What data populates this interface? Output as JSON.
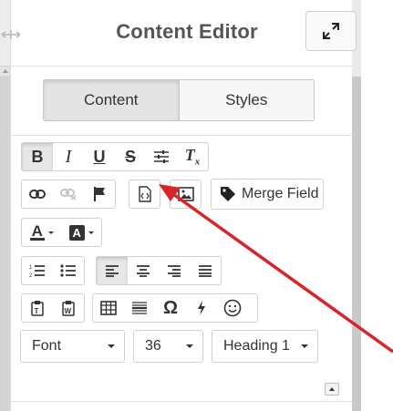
{
  "header": {
    "title": "Content Editor"
  },
  "tabs": [
    {
      "label": "Content",
      "active": true
    },
    {
      "label": "Styles",
      "active": false
    }
  ],
  "toolbar": {
    "row1": [
      {
        "name": "bold-button",
        "glyph": "B"
      },
      {
        "name": "italic-button",
        "glyph": "I"
      },
      {
        "name": "underline-button",
        "glyph": "U"
      },
      {
        "name": "strikethrough-button",
        "glyph": "S"
      },
      {
        "name": "indent-settings-button",
        "icon": "sliders-icon"
      },
      {
        "name": "clear-format-button",
        "glyph": "Tx"
      }
    ],
    "row2_icons": [
      "link-icon",
      "unlink-icon",
      "flag-icon",
      "source-code-icon",
      "image-icon"
    ],
    "merge_field": {
      "label": "Merge Field",
      "icon": "tag-icon"
    },
    "font_color": {
      "glyph": "A",
      "icon": "font-color-icon"
    },
    "bg_color": {
      "glyph": "A",
      "icon": "background-color-icon"
    },
    "lists": [
      "numbered-list-icon",
      "bulleted-list-icon"
    ],
    "alignment": [
      "align-left-icon",
      "align-center-icon",
      "align-right-icon",
      "align-justify-icon"
    ],
    "alignment_active": "align-left-icon",
    "insert": [
      "paste-text-icon",
      "paste-word-icon",
      "table-icon",
      "horizontal-rule-icon",
      "special-char-icon",
      "flash-icon",
      "emoji-icon"
    ],
    "special_char_glyph": "Ω",
    "font_select": {
      "value": "Font"
    },
    "size_select": {
      "value": "36"
    },
    "format_select": {
      "value": "Heading 1"
    }
  },
  "colors": {
    "arrow": "#d7262b",
    "active_tab": "#e4e4e4",
    "border": "#d0d0d0"
  }
}
